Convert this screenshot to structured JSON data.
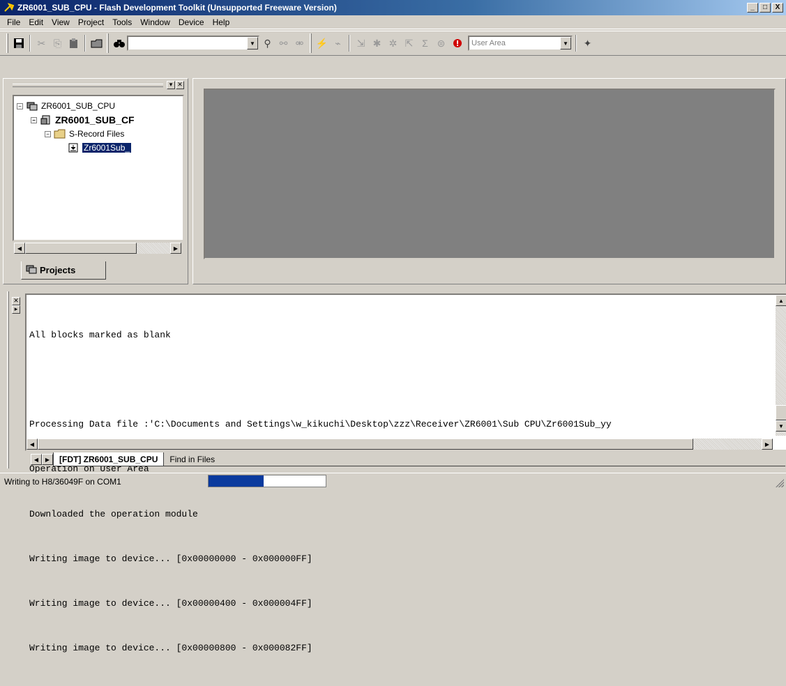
{
  "window": {
    "title": "ZR6001_SUB_CPU - Flash Development Toolkit  (Unsupported Freeware Version)",
    "minimize": "_",
    "maximize": "□",
    "close": "X"
  },
  "menubar": [
    {
      "label": "File"
    },
    {
      "label": "Edit"
    },
    {
      "label": "View"
    },
    {
      "label": "Project"
    },
    {
      "label": "Tools"
    },
    {
      "label": "Window"
    },
    {
      "label": "Device"
    },
    {
      "label": "Help"
    }
  ],
  "toolbar": {
    "search_value": "",
    "area_select": "User Area"
  },
  "project_tree": {
    "items": [
      {
        "label": "ZR6001_SUB_CPU",
        "level": 0
      },
      {
        "label": "ZR6001_SUB_CF",
        "level": 1
      },
      {
        "label": "S-Record Files",
        "level": 2
      },
      {
        "label": "Zr6001Sub_",
        "level": 3
      }
    ],
    "tab_label": "Projects"
  },
  "output": {
    "lines": [
      "All blocks marked as blank",
      "",
      "Processing Data file :'C:\\Documents and Settings\\w_kikuchi\\Desktop\\zzz\\Receiver\\ZR6001\\Sub CPU\\Zr6001Sub_yy",
      "Operation on User Area",
      "Downloaded the operation module",
      "Writing image to device... [0x00000000 - 0x000000FF]",
      "Writing image to device... [0x00000400 - 0x000004FF]",
      "Writing image to device... [0x00000800 - 0x000082FF]"
    ],
    "tabs": [
      {
        "label": "[FDT] ZR6001_SUB_CPU",
        "active": true
      },
      {
        "label": "Find in Files",
        "active": false
      }
    ]
  },
  "statusbar": {
    "text": "Writing to H8/36049F on COM1",
    "progress": 0.47
  }
}
